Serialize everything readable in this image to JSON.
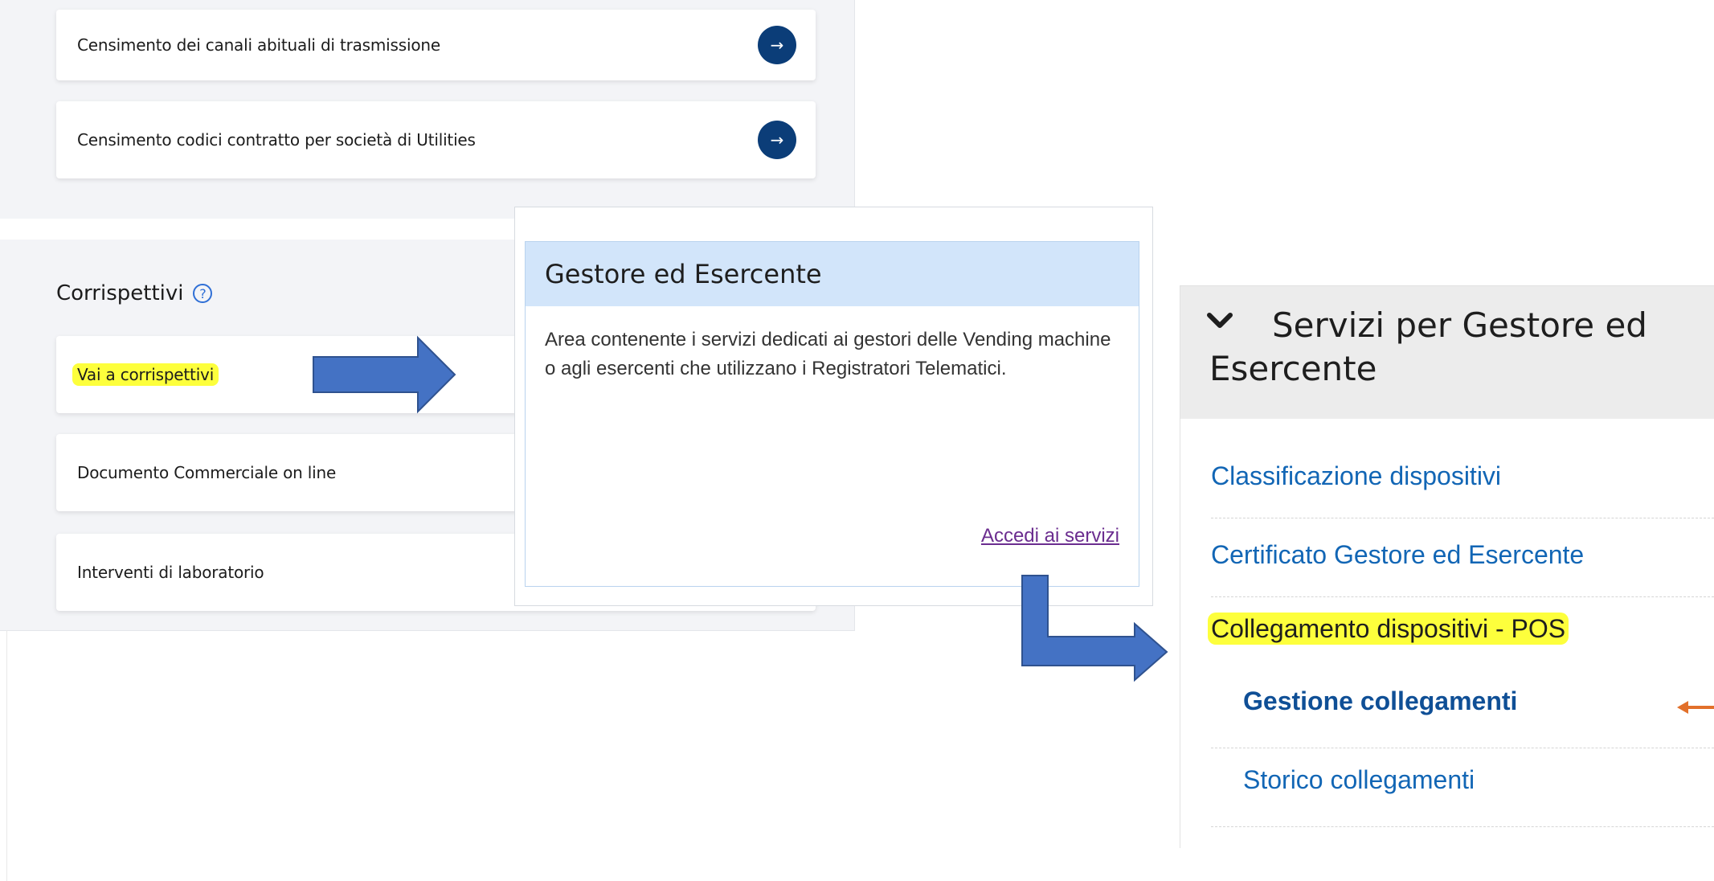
{
  "left": {
    "cards_top": [
      {
        "label": "Censimento dei canali abituali di trasmissione",
        "arrow": "→"
      },
      {
        "label": "Censimento codici contratto per società di Utilities",
        "arrow": "→"
      }
    ],
    "section_title": "Corrispettivi",
    "help_icon": "?",
    "cards_bottom": [
      {
        "label": "Vai a corrispettivi"
      },
      {
        "label": "Documento Commerciale on line"
      },
      {
        "label": "Interventi di laboratorio"
      }
    ]
  },
  "middle": {
    "title": "Gestore ed Esercente",
    "description": "Area contenente i servizi dedicati ai gestori delle Vending machine o agli esercenti che utilizzano i Registratori Telematici.",
    "link": "Accedi ai servizi"
  },
  "right": {
    "title": "Servizi per Gestore ed Esercente",
    "items": [
      {
        "label": "Classificazione dispositivi"
      },
      {
        "label": "Certificato Gestore ed Esercente"
      },
      {
        "label": "Collegamento dispositivi - POS"
      },
      {
        "label": "Gestione collegamenti"
      },
      {
        "label": "Storico collegamenti"
      }
    ]
  },
  "colors": {
    "highlight": "#fdff3c",
    "annotation_arrow": "#4472c4",
    "orange_arrow": "#e2702a",
    "link_blue": "#1266b5",
    "dark_navy": "#0b3d78"
  }
}
